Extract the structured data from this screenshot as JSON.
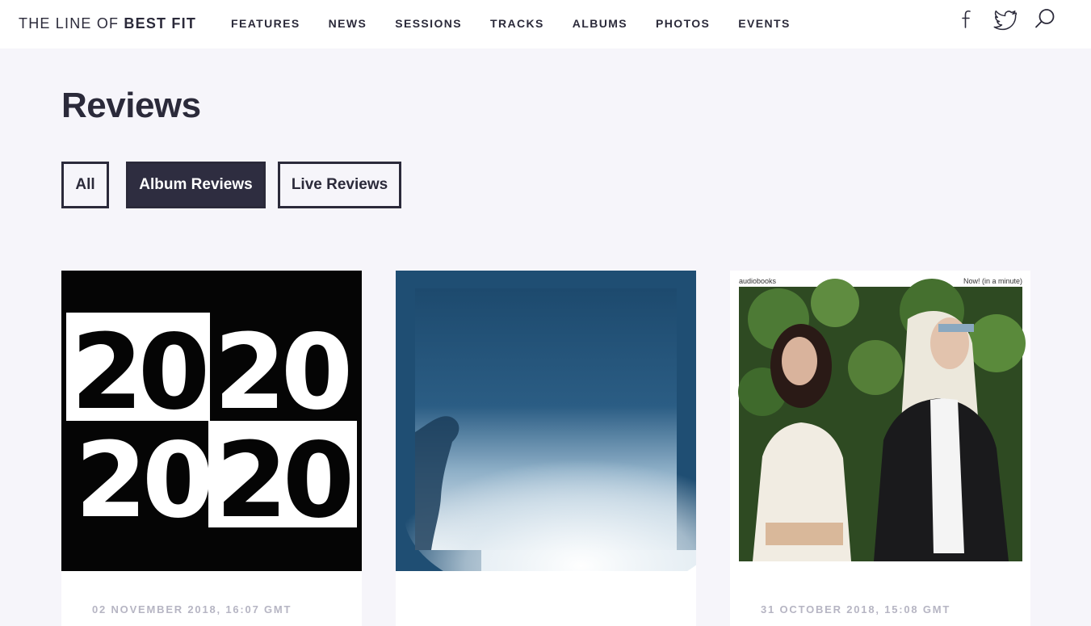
{
  "header": {
    "logo_light": "THE LINE OF ",
    "logo_bold": "BEST FIT",
    "nav": [
      "FEATURES",
      "NEWS",
      "SESSIONS",
      "TRACKS",
      "ALBUMS",
      "PHOTOS",
      "EVENTS"
    ],
    "icons": [
      "facebook-icon",
      "twitter-icon",
      "search-icon"
    ]
  },
  "page": {
    "title": "Reviews",
    "filters": [
      {
        "label": "All",
        "active": false
      },
      {
        "label": "Album Reviews",
        "active": true
      },
      {
        "label": "Live Reviews",
        "active": false
      }
    ]
  },
  "cards": [
    {
      "date": "02 NOVEMBER 2018, 16:07 GMT",
      "art_text": [
        "20",
        "20",
        "20",
        "20"
      ]
    },
    {
      "date": ""
    },
    {
      "date": "31 OCTOBER 2018, 15:08 GMT",
      "artist": "audiobooks",
      "album": "Now! (in a minute)"
    }
  ],
  "colors": {
    "background": "#f6f5fa",
    "text": "#2b2a3a",
    "active_filter": "#2e2d40",
    "date_text": "#b6b5c3",
    "album2_blue": "#1f4e73"
  }
}
